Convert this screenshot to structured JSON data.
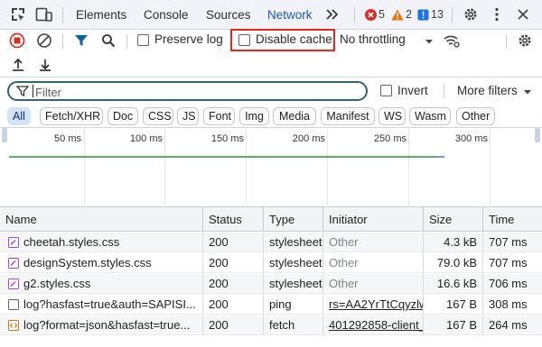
{
  "tabs": [
    "Elements",
    "Console",
    "Sources",
    "Network"
  ],
  "active_tab": "Network",
  "badges": {
    "errors": "5",
    "warnings": "2",
    "issues": "13"
  },
  "toolbar": {
    "preserve_log": "Preserve log",
    "disable_cache": "Disable cache",
    "throttling": "No throttling"
  },
  "filter": {
    "placeholder": "Filter",
    "invert": "Invert",
    "more_filters": "More filters"
  },
  "type_filters": [
    "All",
    "Fetch/XHR",
    "Doc",
    "CSS",
    "JS",
    "Font",
    "Img",
    "Media",
    "Manifest",
    "WS",
    "Wasm",
    "Other"
  ],
  "timeline": {
    "ticks": [
      "50 ms",
      "100 ms",
      "150 ms",
      "200 ms",
      "250 ms",
      "300 ms"
    ]
  },
  "table": {
    "columns": [
      "Name",
      "Status",
      "Type",
      "Initiator",
      "Size",
      "Time"
    ],
    "rows": [
      {
        "name": "cheetah.styles.css",
        "status": "200",
        "type": "stylesheet",
        "initiator": "Other",
        "size": "4.3 kB",
        "time": "707 ms",
        "icon": "stylesheet-icon"
      },
      {
        "name": "designSystem.styles.css",
        "status": "200",
        "type": "stylesheet",
        "initiator": "Other",
        "size": "79.0 kB",
        "time": "707 ms",
        "icon": "stylesheet-icon"
      },
      {
        "name": "g2.styles.css",
        "status": "200",
        "type": "stylesheet",
        "initiator": "Other",
        "size": "16.6 kB",
        "time": "706 ms",
        "icon": "stylesheet-icon"
      },
      {
        "name": "log?hasfast=true&auth=SAPISI...",
        "status": "200",
        "type": "ping",
        "initiator": "rs=AA2YrTtCqyzlw",
        "size": "167 B",
        "time": "308 ms",
        "icon": "document-icon"
      },
      {
        "name": "log?format=json&hasfast=true...",
        "status": "200",
        "type": "fetch",
        "initiator": "401292858-client_j",
        "size": "167 B",
        "time": "264 ms",
        "icon": "fetch-icon"
      }
    ]
  },
  "colors": {
    "accent": "#1a57c8",
    "highlight_box": "#e8261b",
    "record_red": "#d93025",
    "filter_blue": "#0b64a0",
    "timeline_green": "#4fb660",
    "timeline_blue": "#7a9ae0",
    "active_chip": "#d3e3fd"
  }
}
